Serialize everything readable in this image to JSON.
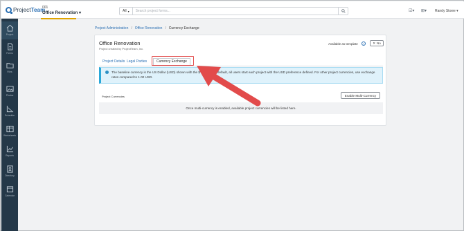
{
  "header": {
    "brand_prefix": "Project",
    "brand_suffix": "Team",
    "project_id": "001",
    "project_name": "Office Renovation ▾",
    "search": {
      "scope": "All",
      "placeholder": "Search project forms..."
    },
    "user": "Randy Stowe ▾"
  },
  "sidebar": {
    "items": [
      {
        "label": "Project",
        "icon": "home-icon"
      },
      {
        "label": "Forms",
        "icon": "document-icon"
      },
      {
        "label": "Files",
        "icon": "folder-icon"
      },
      {
        "label": "Photos",
        "icon": "image-icon"
      },
      {
        "label": "Schedule",
        "icon": "gantt-icon"
      },
      {
        "label": "Worksheets",
        "icon": "table-icon"
      },
      {
        "label": "Reports",
        "icon": "chart-icon"
      },
      {
        "label": "Directory",
        "icon": "contacts-icon"
      },
      {
        "label": "Calendar",
        "icon": "calendar-icon"
      }
    ]
  },
  "breadcrumb": {
    "items": [
      "Project Administration",
      "Office Renovation",
      "Currency Exchange"
    ],
    "separator": "/"
  },
  "card": {
    "title": "Office Renovation",
    "subtitle": "Project created by ProjectTeam, Inc.",
    "template_label": "Available as template",
    "template_toggle": "No",
    "tabs": [
      "Project Details",
      "Legal Parties",
      "Currency Exchange"
    ],
    "active_tab": "Currency Exchange",
    "info_text": "The baseline currency is the US Dollar (USD) shown with the $ symbol. By default, all users start each project with the USD preference defined. For other project currencies, use exchange rates compared to 1.00 USD.",
    "currencies_label": "Project Currencies",
    "enable_button": "Enable Multi-Currency",
    "empty_text": "Once multi-currency is enabled, available project currencies will be listed here."
  },
  "colors": {
    "sidebar_bg": "#243848",
    "accent": "#2a6fb3",
    "highlight": "#e24b4b",
    "info_bg": "#dff2fb"
  }
}
